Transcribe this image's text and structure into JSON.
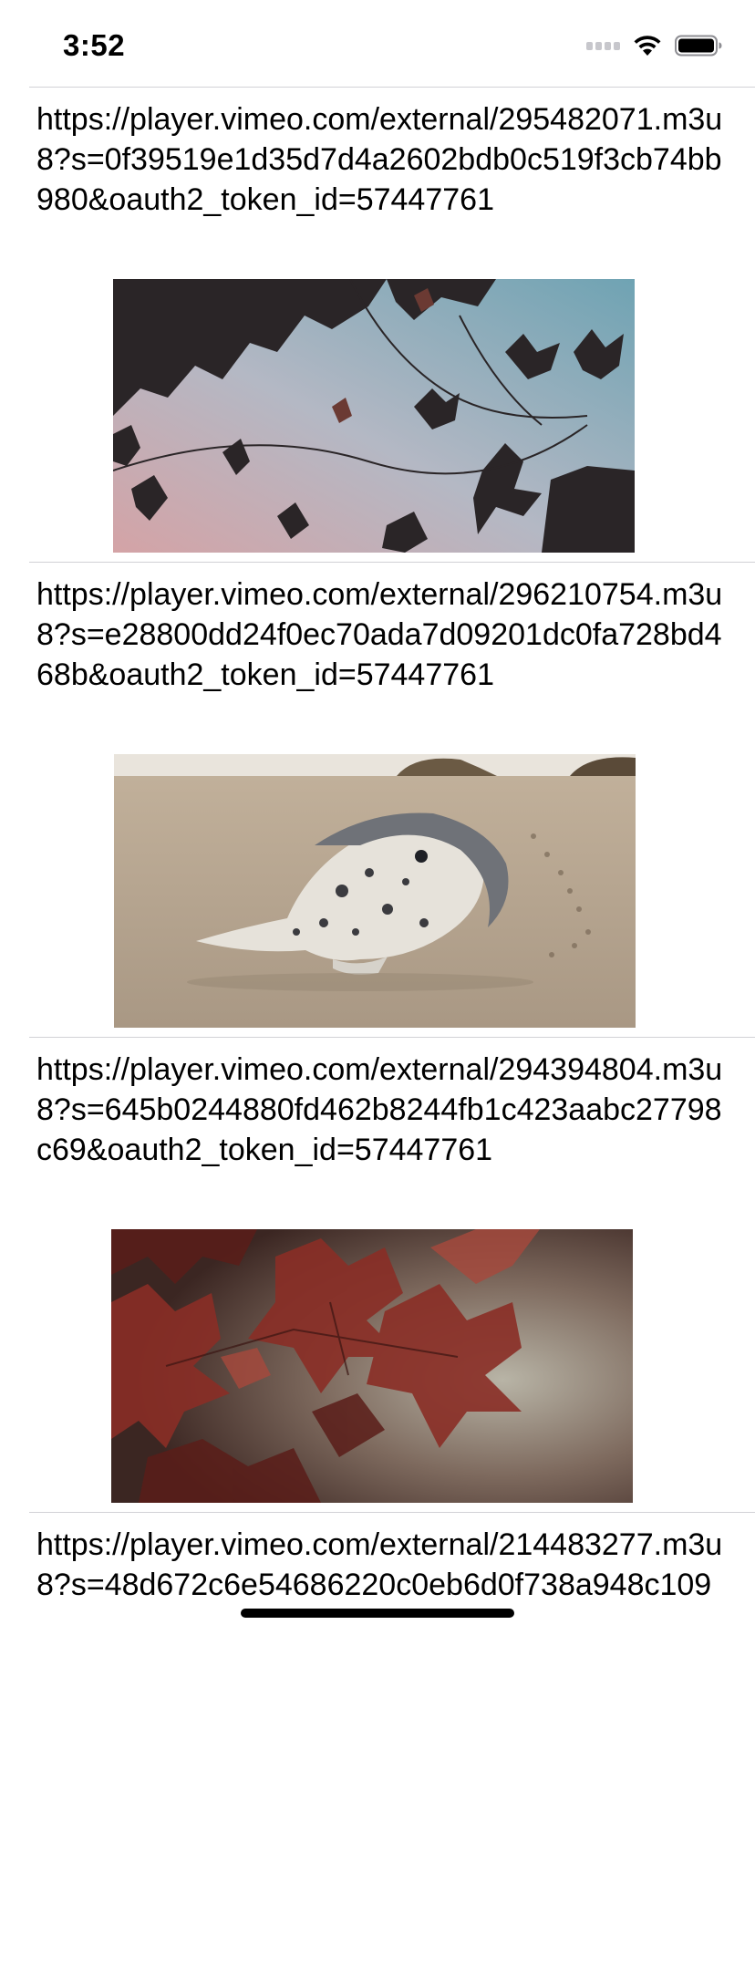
{
  "status_bar": {
    "time": "3:52",
    "icons": [
      "cellular-signal-icon",
      "wifi-icon",
      "battery-icon"
    ]
  },
  "videos": [
    {
      "url": "https://player.vimeo.com/external/295482071.m3u8?s=0f39519e1d35d7d4a2602bdb0c519f3cb74bb980&oauth2_token_id=57447761",
      "thumbnail": "autumn-leaves-silhouette-thumbnail"
    },
    {
      "url": "https://player.vimeo.com/external/296210754.m3u8?s=e28800dd24f0ec70ada7d09201dc0fa728bd468b&oauth2_token_id=57447761",
      "thumbnail": "seal-on-beach-thumbnail"
    },
    {
      "url": "https://player.vimeo.com/external/294394804.m3u8?s=645b0244880fd462b8244fb1c423aabc27798c69&oauth2_token_id=57447761",
      "thumbnail": "red-maple-leaves-thumbnail"
    },
    {
      "url": "https://player.vimeo.com/external/214483277.m3u8?s=48d672c6e54686220c0eb6d0f738a948c109",
      "thumbnail": ""
    }
  ],
  "colors": {
    "separator": "#d1d1d6",
    "background": "#ffffff",
    "text": "#000000"
  }
}
